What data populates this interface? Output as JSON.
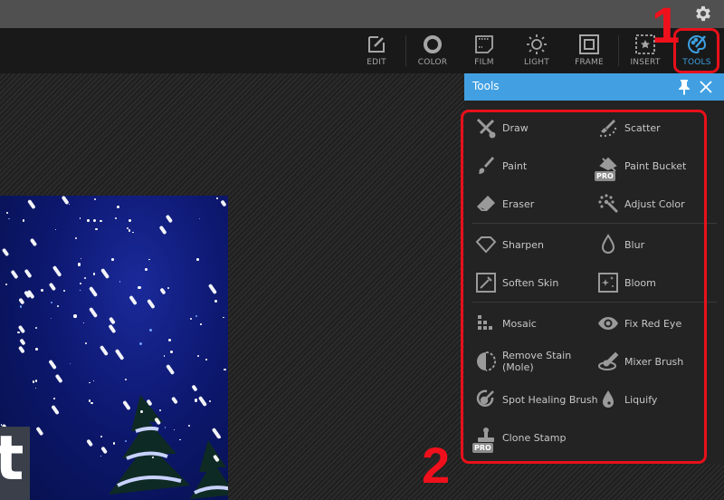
{
  "topbar": {
    "settings_icon": "gear-icon"
  },
  "toolbar": {
    "items": [
      {
        "label": "EDIT",
        "icon": "edit-icon",
        "active": false
      },
      {
        "label": "COLOR",
        "icon": "color-circle-icon",
        "active": false
      },
      {
        "label": "FILM",
        "icon": "film-icon",
        "active": false
      },
      {
        "label": "LIGHT",
        "icon": "light-sun-icon",
        "active": false
      },
      {
        "label": "FRAME",
        "icon": "frame-icon",
        "active": false
      },
      {
        "label": "INSERT",
        "icon": "insert-star-icon",
        "active": false
      },
      {
        "label": "TOOLS",
        "icon": "palette-brush-icon",
        "active": true
      }
    ],
    "active_color": "#3d9fe0"
  },
  "canvas": {
    "image_overlay_letter": "t"
  },
  "panel": {
    "title": "Tools",
    "header_color": "#42a0e2",
    "groups": [
      [
        {
          "label": "Draw",
          "icon": "draw-icon",
          "pro": false
        },
        {
          "label": "Scatter",
          "icon": "scatter-icon",
          "pro": false
        },
        {
          "label": "Paint",
          "icon": "paint-brush-icon",
          "pro": false
        },
        {
          "label": "Paint Bucket",
          "icon": "paint-bucket-icon",
          "pro": true
        },
        {
          "label": "Eraser",
          "icon": "eraser-icon",
          "pro": false
        },
        {
          "label": "Adjust Color",
          "icon": "adjust-color-wand-icon",
          "pro": false
        }
      ],
      [
        {
          "label": "Sharpen",
          "icon": "diamond-icon",
          "pro": false
        },
        {
          "label": "Blur",
          "icon": "droplet-outline-icon",
          "pro": false
        },
        {
          "label": "Soften Skin",
          "icon": "soften-skin-icon",
          "pro": false
        },
        {
          "label": "Bloom",
          "icon": "bloom-sparkle-icon",
          "pro": false
        }
      ],
      [
        {
          "label": "Mosaic",
          "icon": "mosaic-icon",
          "pro": false
        },
        {
          "label": "Fix Red Eye",
          "icon": "eye-icon",
          "pro": false
        },
        {
          "label": "Remove Stain (Mole)",
          "icon": "half-circle-icon",
          "pro": false
        },
        {
          "label": "Mixer Brush",
          "icon": "mixer-brush-icon",
          "pro": false
        },
        {
          "label": "Spot Healing Brush",
          "icon": "spot-healing-icon",
          "pro": false
        },
        {
          "label": "Liquify",
          "icon": "droplet-filled-icon",
          "pro": false
        },
        {
          "label": "Clone Stamp",
          "icon": "clone-stamp-icon",
          "pro": true
        }
      ]
    ],
    "pro_badge": "PRO"
  },
  "annotations": {
    "step1": "1",
    "step2": "2",
    "color": "#e8101a"
  }
}
